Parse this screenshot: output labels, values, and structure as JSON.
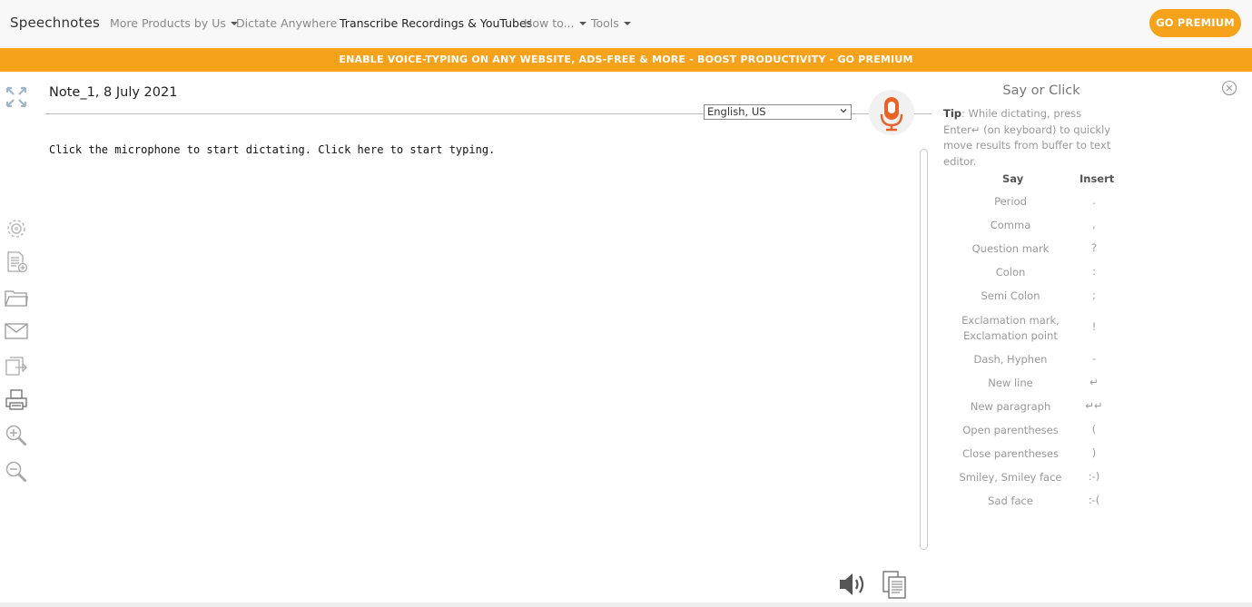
{
  "nav": {
    "brand": "Speechnotes",
    "items": [
      {
        "label": "More Products by Us",
        "has_caret": true
      },
      {
        "label": "Dictate Anywhere",
        "has_caret": false
      },
      {
        "label": "Transcribe Recordings & YouTubes",
        "has_caret": false
      },
      {
        "label": "How to...",
        "has_caret": true
      },
      {
        "label": "Tools",
        "has_caret": true
      }
    ],
    "premium_button": "GO PREMIUM"
  },
  "banner": {
    "text": "ENABLE VOICE-TYPING ON ANY WEBSITE, ADS-FREE & MORE  -  BOOST PRODUCTIVITY - GO PREMIUM"
  },
  "toolbar": {
    "icons": [
      "fullscreen-icon",
      "settings-gear-icon",
      "new-note-icon",
      "open-folder-icon",
      "email-icon",
      "export-icon",
      "print-icon",
      "zoom-in-icon",
      "zoom-out-icon"
    ]
  },
  "note": {
    "title": "Note_1, 8 July 2021",
    "language": "English, US",
    "editor_placeholder": "Click the microphone to start dictating. Click here to start typing."
  },
  "panel": {
    "title": "Say or Click",
    "tip_label": "Tip",
    "tip_text": ": While dictating, press Enter↵ (on keyboard) to quickly move results from buffer to text editor.",
    "col_say": "Say",
    "col_insert": "Insert",
    "commands": [
      {
        "say": "Period",
        "insert": "."
      },
      {
        "say": "Comma",
        "insert": ","
      },
      {
        "say": "Question mark",
        "insert": "?"
      },
      {
        "say": "Colon",
        "insert": ":"
      },
      {
        "say": "Semi Colon",
        "insert": ";"
      },
      {
        "say": "Exclamation mark, Exclamation point",
        "insert": "!"
      },
      {
        "say": "Dash, Hyphen",
        "insert": "-"
      },
      {
        "say": "New line",
        "insert": "↵"
      },
      {
        "say": "New paragraph",
        "insert": "↵↵"
      },
      {
        "say": "Open parentheses",
        "insert": "("
      },
      {
        "say": "Close parentheses",
        "insert": ")"
      },
      {
        "say": "Smiley, Smiley face",
        "insert": ":-)"
      },
      {
        "say": "Sad face",
        "insert": ":-("
      }
    ]
  },
  "bottom": {
    "icons": [
      "speaker-icon",
      "copy-clipboard-icon"
    ]
  },
  "colors": {
    "accent": "#f7a21b",
    "mic": "#e8632a"
  }
}
